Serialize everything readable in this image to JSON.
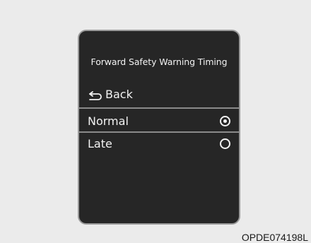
{
  "screen": {
    "title": "Forward Safety Warning Timing",
    "back_label": "Back",
    "options": [
      {
        "label": "Normal",
        "selected": true
      },
      {
        "label": "Late",
        "selected": false
      }
    ]
  },
  "image_code": "OPDE074198L",
  "icons": {
    "back": "return-arrow-icon",
    "radio_selected": "radio-selected-icon",
    "radio_unselected": "radio-unselected-icon"
  }
}
